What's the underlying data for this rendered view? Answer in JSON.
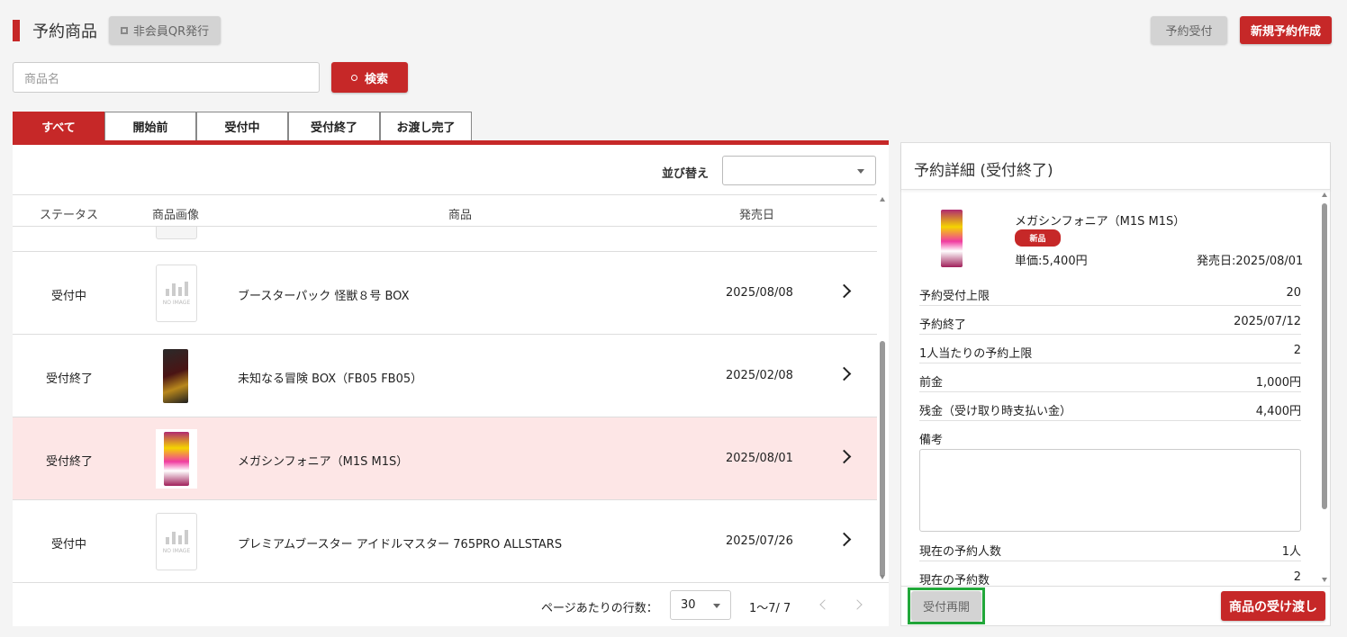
{
  "header": {
    "title": "予約商品",
    "qr_button": "非会員QR発行",
    "reception_button": "予約受付",
    "create_button": "新規予約作成"
  },
  "search": {
    "placeholder": "商品名",
    "button": "検索"
  },
  "tabs": [
    {
      "label": "すべて",
      "active": true
    },
    {
      "label": "開始前",
      "active": false
    },
    {
      "label": "受付中",
      "active": false
    },
    {
      "label": "受付終了",
      "active": false
    },
    {
      "label": "お渡し完了",
      "active": false
    }
  ],
  "list": {
    "sort_label": "並び替え",
    "sort_value": "",
    "columns": [
      "ステータス",
      "商品画像",
      "商品",
      "発売日"
    ],
    "rows": [
      {
        "status": "受付中",
        "image": "no-image",
        "product": "ブースターパック 怪獣８号 BOX",
        "release": "2025/08/08",
        "selected": false
      },
      {
        "status": "受付終了",
        "image": "box",
        "product": "未知なる冒険 BOX（FB05 FB05）",
        "release": "2025/02/08",
        "selected": false
      },
      {
        "status": "受付終了",
        "image": "pack",
        "product": "メガシンフォニア（M1S M1S）",
        "release": "2025/08/01",
        "selected": true
      },
      {
        "status": "受付中",
        "image": "no-image",
        "product": "プレミアムブースター アイドルマスター 765PRO ALLSTARS",
        "release": "2025/07/26",
        "selected": false
      }
    ],
    "no_image_text": "NO IMAGE"
  },
  "pagination": {
    "rows_per_page_label": "ページあたりの行数：",
    "rows_per_page": "30",
    "range": "1〜7/ 7"
  },
  "detail": {
    "title": "予約詳細 (受付終了)",
    "product_name": "メガシンフォニア（M1S M1S）",
    "badge": "新品",
    "unit_price": "単価:5,400円",
    "release_date": "発売日:2025/08/01",
    "fields": [
      {
        "label": "予約受付上限",
        "value": "20"
      },
      {
        "label": "予約終了",
        "value": "2025/07/12"
      },
      {
        "label": "1人当たりの予約上限",
        "value": "2"
      },
      {
        "label": "前金",
        "value": "1,000円"
      },
      {
        "label": "残金（受け取り時支払い金）",
        "value": "4,400円"
      }
    ],
    "notes_label": "備考",
    "notes_value": "",
    "bottom_fields": [
      {
        "label": "現在の予約人数",
        "value": "1人"
      },
      {
        "label": "現在の予約数",
        "value": "2"
      }
    ],
    "reopen_button": "受付再開",
    "handover_button": "商品の受け渡し"
  },
  "colors": {
    "accent": "#c62828",
    "selected_row": "#fde6e6",
    "highlight_outline": "#22a83a"
  }
}
